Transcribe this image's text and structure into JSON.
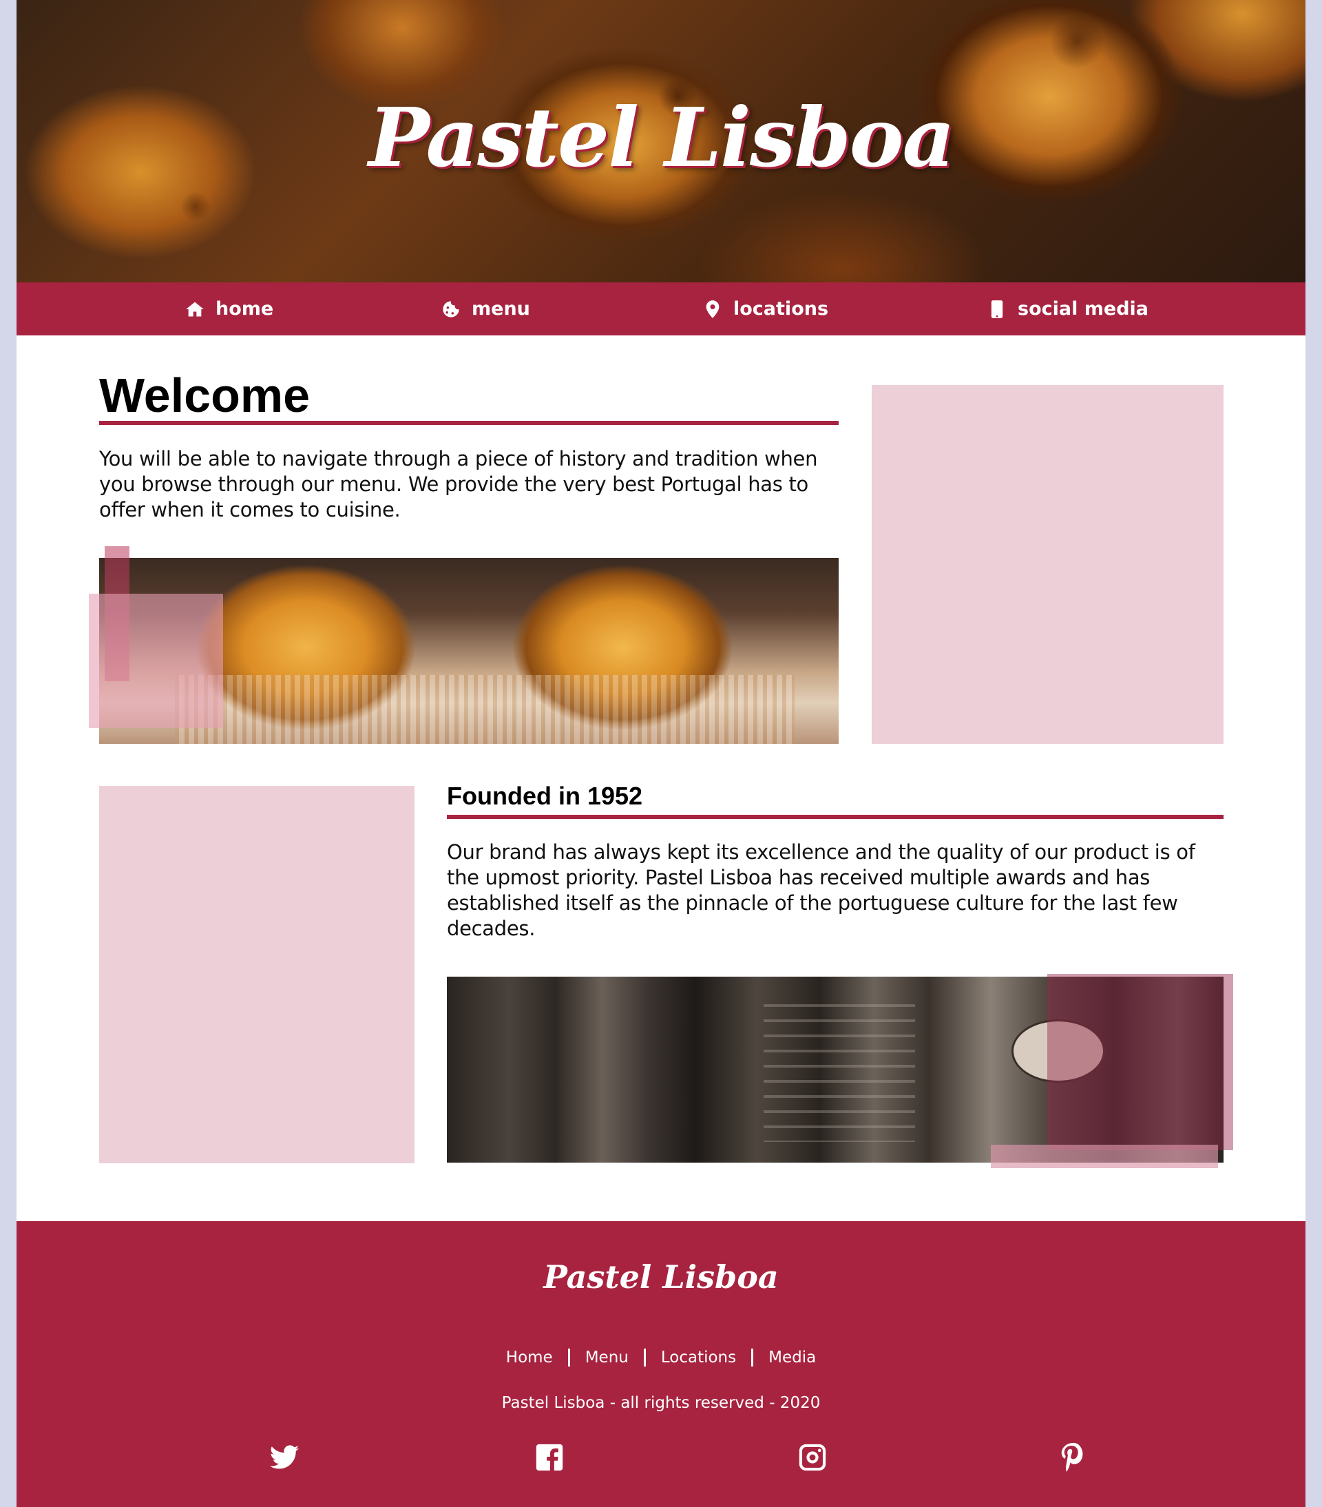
{
  "brand": {
    "name": "Pastel Lisboa",
    "accent_color": "#a82340",
    "soft_pink": "#edcfd8",
    "page_bg": "#d4d6ea"
  },
  "nav": {
    "items": [
      {
        "label": "home",
        "icon": "home-icon"
      },
      {
        "label": "menu",
        "icon": "cookie-icon"
      },
      {
        "label": "locations",
        "icon": "map-pin-icon"
      },
      {
        "label": "social media",
        "icon": "mobile-phone-icon"
      }
    ]
  },
  "welcome": {
    "title": "Welcome",
    "body": "You will be able to navigate through a piece of history and tradition when you browse through our menu. We provide the very best Portugal has to offer when it comes to cuisine."
  },
  "founded": {
    "title": "Founded in 1952",
    "body": "Our brand has always kept its excellence and the quality of our product is of the upmost priority. Pastel Lisboa has received multiple awards and has established itself as the pinnacle of the portuguese culture for the last few decades."
  },
  "footer": {
    "logo": "Pastel Lisboa",
    "links": [
      "Home",
      "Menu",
      "Locations",
      "Media"
    ],
    "copyright": "Pastel Lisboa - all rights reserved - 2020",
    "social": [
      "twitter-icon",
      "facebook-icon",
      "instagram-icon",
      "pinterest-icon"
    ]
  }
}
